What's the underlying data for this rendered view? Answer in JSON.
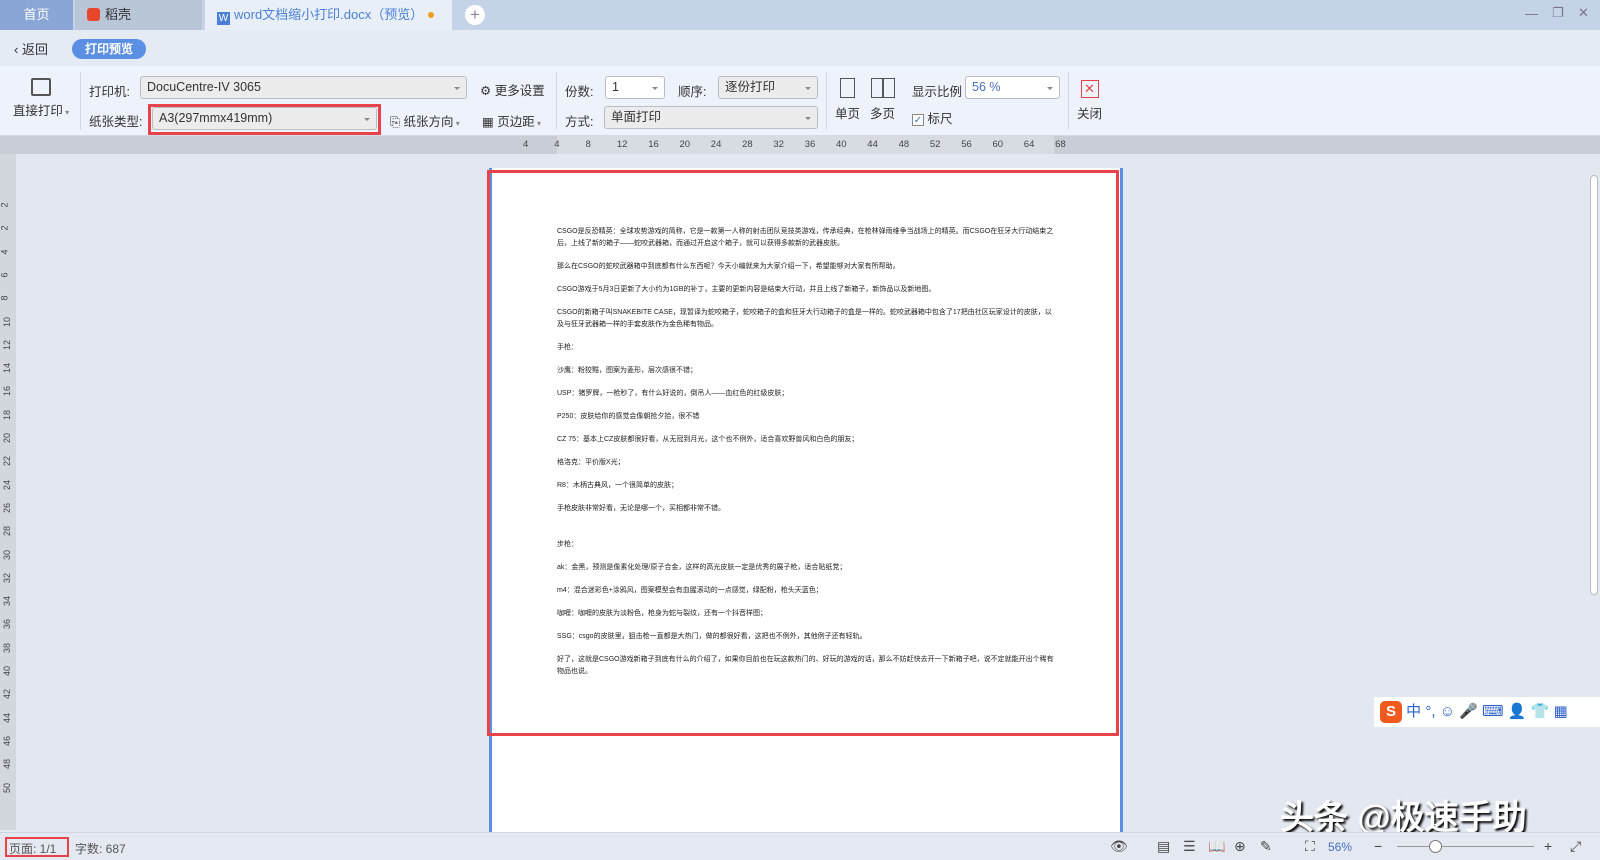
{
  "tabs": [
    {
      "label": "首页"
    },
    {
      "label": "稻壳"
    },
    {
      "label": "word文档缩小打印.docx（预览）"
    }
  ],
  "nav": {
    "back": "返回",
    "mode": "打印预览"
  },
  "toolbar": {
    "direct_print": "直接打印",
    "printer_label": "打印机:",
    "printer": "DocuCentre-IV 3065",
    "more_settings": "更多设置",
    "paper_label": "纸张类型:",
    "paper": "A3(297mmx419mm)",
    "orientation": "纸张方向",
    "margins": "页边距",
    "copies_label": "份数:",
    "copies": "1",
    "order_label": "顺序:",
    "order": "逐份打印",
    "method_label": "方式:",
    "method": "单面打印",
    "single_page": "单页",
    "multi_page": "多页",
    "zoom_label": "显示比例",
    "zoom": "56 %",
    "ruler": "标尺",
    "ruler_checked": true,
    "close": "关闭"
  },
  "ruler_ticks": [
    "4",
    "4",
    "8",
    "12",
    "16",
    "20",
    "24",
    "28",
    "32",
    "36",
    "40",
    "44",
    "48",
    "52",
    "56",
    "60",
    "64",
    "68"
  ],
  "left_ruler_ticks": [
    "2",
    "2",
    "4",
    "6",
    "8",
    "10",
    "12",
    "14",
    "16",
    "18",
    "20",
    "22",
    "24",
    "26",
    "28",
    "30",
    "32",
    "34",
    "36",
    "38",
    "40",
    "42",
    "44",
    "46",
    "48",
    "50"
  ],
  "document": {
    "paragraphs": [
      "CSGO是反恐精英：全球攻势游戏的简称，它是一款第一人称的射击团队竞技类游戏，传承经典，在枪林弹雨维争当战场上的精英。而CSGO在狂牙大行动结束之后，上线了新的箱子——蛇咬武器箱，而通过开启这个箱子，就可以获得多款新的武器皮肤。",
      "那么在CSGO的蛇咬武器箱中到底都有什么东西呢？今天小编就来为大家介绍一下，希望能够对大家有所帮助。",
      "CSGO游戏于5月3日更新了大小约为1GB的补丁，主要的更新内容是结束大行动，并且上线了新箱子，新饰品以及新地图。",
      "CSGO的新箱子叫SNAKEBITE CASE，现暂译为蛇咬箱子，蛇咬箱子的盒和狂牙大行动箱子的盒是一样的。蛇咬武器箱中包含了17把由社区玩家设计的皮肤，以及与狂牙武器箱一样的手套皮肤作为金色稀有物品。",
      "手枪：",
      "沙鹰：粉狡黠，图案为菱形，层次感很不错；",
      "USP：猪罗牌，一枪秒了，有什么好说的，倒吊人——血红色的红级皮肤；",
      "P250：皮肤给你的感觉会像朝抢夕拾，很不错",
      "CZ 75：基本上CZ皮肤都很好看，从无冠到月光，这个也不例外，适合喜欢野兽风和白色的朋友；",
      "格洛克：平价版X光；",
      "R8：木柄古典风，一个很简单的皮肤；",
      "手枪皮肤非常好看，无论是哪一个，买相都非常不错。",
      "",
      "步枪：",
      "ak：金黑，预测是像素化处理/原子合金，这样的高光皮肤一定是优秀的展子枪，适合贴纸党；",
      "m4：混合迷彩色+涂鸦风，图案模型会有血腥滚动的一点感觉，绿配粉，枪头天蓝色；",
      "咖喱：咖喱的皮肤为淡粉色，枪身为蛇与裂纹，还有一个抖音样图；",
      "SSG：csgo的皮肤里，狙击枪一直都是大热门，做的都很好看，这把也不例外，其他例子还有轻轨。",
      "好了，这就是CSGO游戏新箱子到底有什么的介绍了，如果你目前也在玩这款热门的、好玩的游戏的话，那么不妨赶快去开一下新箱子吧，说不定就能开出个稀有物品也说。"
    ]
  },
  "status": {
    "page": "页面: 1/1",
    "words": "字数: 687",
    "zoom": "56%",
    "zoom_fraction": 0.28
  },
  "ime": {
    "label": "中"
  },
  "watermark": "头条 @极速手助",
  "colors": {
    "accent": "#5b8fe4",
    "highlight": "#e8424a"
  }
}
